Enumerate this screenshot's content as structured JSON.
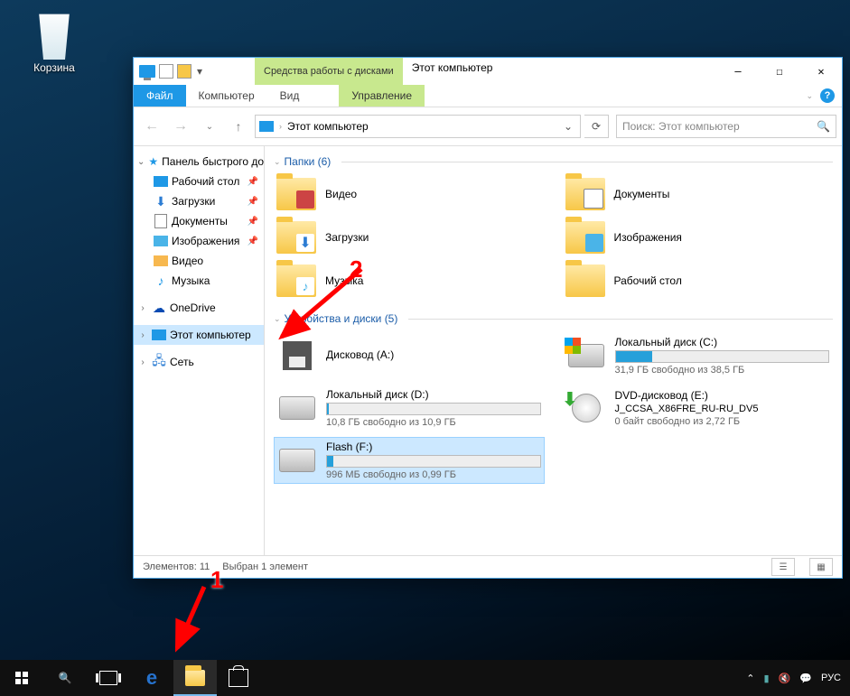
{
  "desktop": {
    "recycle_bin": "Корзина"
  },
  "titlebar": {
    "context_tab": "Средства работы с дисками",
    "title": "Этот компьютер"
  },
  "ribbon": {
    "file": "Файл",
    "computer": "Компьютер",
    "view": "Вид",
    "manage": "Управление"
  },
  "address": {
    "path": "Этот компьютер"
  },
  "search": {
    "placeholder": "Поиск: Этот компьютер"
  },
  "sidebar": {
    "quick_access": "Панель быстрого до",
    "desktop": "Рабочий стол",
    "downloads": "Загрузки",
    "documents": "Документы",
    "pictures": "Изображения",
    "videos": "Видео",
    "music": "Музыка",
    "onedrive": "OneDrive",
    "this_pc": "Этот компьютер",
    "network": "Сеть"
  },
  "groups": {
    "folders": "Папки (6)",
    "devices": "Устройства и диски (5)"
  },
  "folders": {
    "video": "Видео",
    "documents": "Документы",
    "downloads": "Загрузки",
    "pictures": "Изображения",
    "music": "Музыка",
    "desktop": "Рабочий стол"
  },
  "drives": {
    "floppy": {
      "name": "Дисковод (A:)"
    },
    "c": {
      "name": "Локальный диск (C:)",
      "sub": "31,9 ГБ свободно из 38,5 ГБ",
      "pct": 17
    },
    "d": {
      "name": "Локальный диск (D:)",
      "sub": "10,8 ГБ свободно из 10,9 ГБ",
      "pct": 1
    },
    "dvd": {
      "name": "DVD-дисковод (E:)",
      "line2": "J_CCSA_X86FRE_RU-RU_DV5",
      "sub": "0 байт свободно из 2,72 ГБ"
    },
    "flash": {
      "name": "Flash (F:)",
      "sub": "996 МБ свободно из 0,99 ГБ",
      "pct": 3
    }
  },
  "status": {
    "count": "Элементов: 11",
    "selected": "Выбран 1 элемент"
  },
  "annotations": {
    "n1": "1",
    "n2": "2"
  },
  "tray": {
    "lang": "РУС"
  }
}
